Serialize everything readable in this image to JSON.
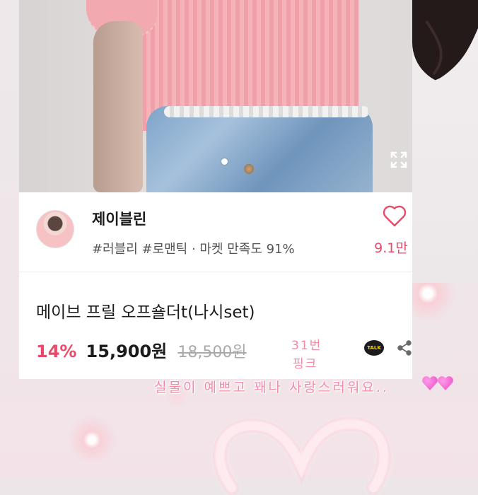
{
  "shop": {
    "name": "제이블린",
    "meta": "#러블리 #로맨틱 · 마켓 만족도 91%",
    "like_count": "9.1만"
  },
  "product": {
    "title": "메이브 프릴 오프숄더t(나시set)",
    "discount": "14%",
    "price": "15,900원",
    "original_price": "18,500원"
  },
  "actions": {
    "talk_label": "TALK"
  },
  "annotations": {
    "number_note": "31번",
    "color_note": "핑크",
    "comment": "실물이 예쁘고 꽤나 사랑스러워요.."
  },
  "colors": {
    "accent_pink": "#e84a6a",
    "note_pink": "#f48aa4",
    "heart_emoji": "#e63cc0"
  },
  "icons": [
    "expand-icon",
    "heart-outline-icon",
    "kakao-talk-icon",
    "share-icon",
    "heart-emoji-icon"
  ]
}
